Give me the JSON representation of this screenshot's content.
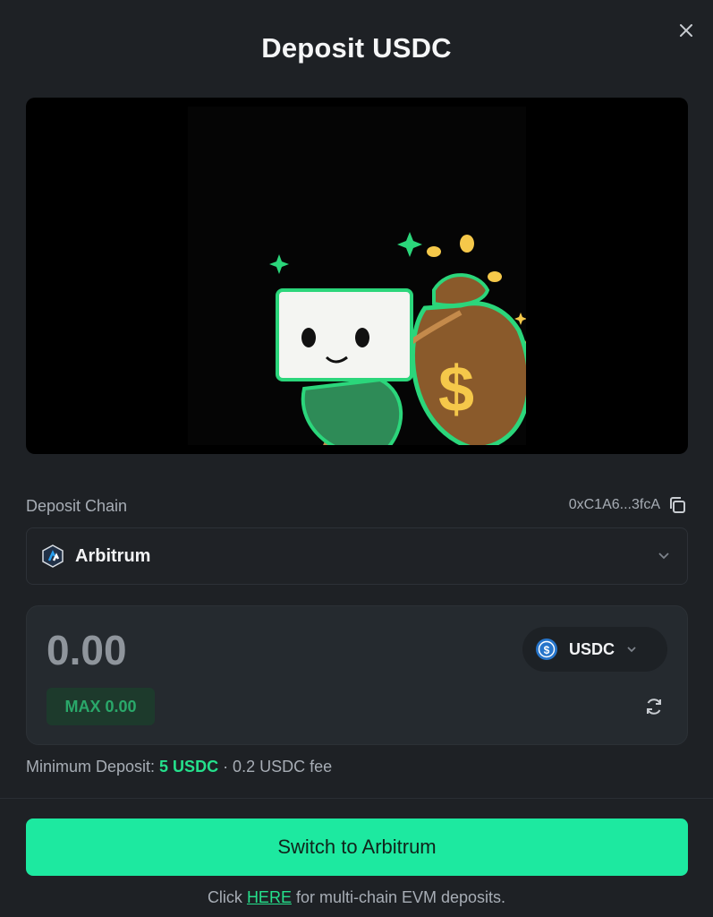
{
  "modal": {
    "title": "Deposit USDC",
    "close_icon": "close-icon"
  },
  "hero": {
    "icon": "mascot-illustration",
    "accent_color": "#2bd67b"
  },
  "deposit_chain": {
    "label": "Deposit Chain",
    "address": "0xC1A6...3fcA",
    "copy_icon": "copy-icon",
    "selected_chain": "Arbitrum",
    "chain_icon": "arbitrum-icon",
    "chevron_icon": "chevron-down-icon"
  },
  "amount": {
    "value": "0.00",
    "token": "USDC",
    "token_icon": "usdc-icon",
    "max_label": "MAX 0.00",
    "refresh_icon": "refresh-icon"
  },
  "minimum": {
    "prefix": "Minimum Deposit: ",
    "amount": "5 USDC",
    "suffix": " · 0.2 USDC fee"
  },
  "actions": {
    "switch_label": "Switch to Arbitrum",
    "button_color": "#1de9a0"
  },
  "footer": {
    "prefix": "Click ",
    "link": "HERE",
    "suffix": " for multi-chain EVM deposits."
  }
}
